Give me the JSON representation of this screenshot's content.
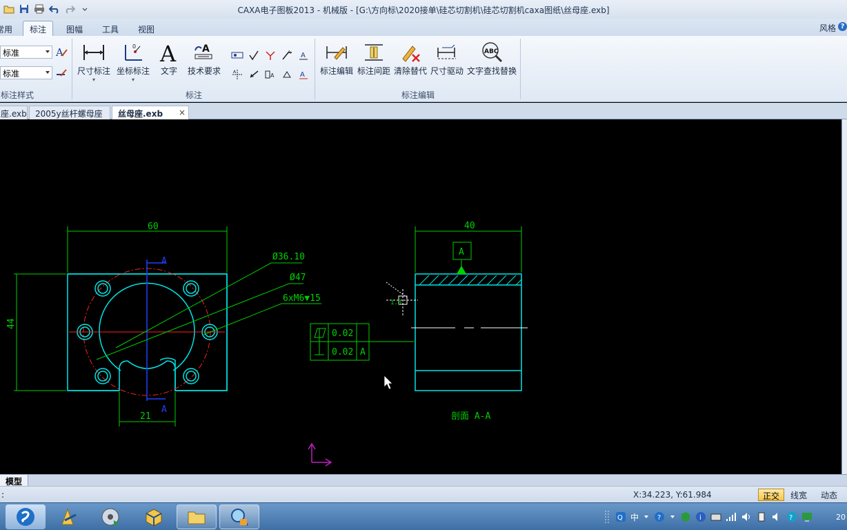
{
  "window": {
    "title": "CAXA电子图板2013 - 机械版 - [G:\\方向标\\2020接单\\硅芯切割机\\硅芯切割机caxa图纸\\丝母座.exb]"
  },
  "ribbon_tabs": [
    {
      "label": "常用",
      "active": false
    },
    {
      "label": "标注",
      "active": true
    },
    {
      "label": "图幅",
      "active": false
    },
    {
      "label": "工具",
      "active": false
    },
    {
      "label": "视图",
      "active": false
    }
  ],
  "ribbon_right": {
    "style_label": "风格",
    "help": "?"
  },
  "style_group": {
    "combo1": "标准",
    "combo2": "标准",
    "label": "标注样式"
  },
  "annotate_group": {
    "buttons": [
      "尺寸标注",
      "坐标标注",
      "文字",
      "技术要求"
    ],
    "label": "标注"
  },
  "edit_group": {
    "buttons": [
      "标注编辑",
      "标注间距",
      "清除替代",
      "尺寸驱动",
      "文字查找替换"
    ],
    "label": "标注编辑"
  },
  "doc_tabs": [
    {
      "label": "座.exb",
      "active": false
    },
    {
      "label": "2005y丝杆螺母座",
      "active": false
    },
    {
      "label": "丝母座.exb",
      "active": true
    }
  ],
  "drawing": {
    "dim_width": "60",
    "dim_height": "44",
    "dim_bottom": "21",
    "dim_d1": "Ø36.10",
    "dim_d2": "Ø47",
    "dim_holes": "6xM6▼15",
    "section_mark_a_top": "A",
    "section_mark_a_bottom": "A",
    "dim_side_width": "40",
    "datum_letter": "A",
    "tol_flat_value": "0.02",
    "tol_perp_value": "0.02",
    "tol_perp_datum": "A",
    "section_label": "剖面 A-A",
    "small_dim": "1.5"
  },
  "model_tab": "模型",
  "status": {
    "prompt": ":",
    "coordinates": "X:34.223, Y:61.984",
    "ortho": "正交",
    "linewidth": "线宽",
    "dynamic_input": "动态输入"
  },
  "tray": {
    "ime": "中",
    "clock": "20"
  },
  "colors": {
    "outline": "#00e5e5",
    "dimension": "#00d000",
    "centerline": "#ff2020",
    "axis": "#2040ff",
    "ucs": "#c020c0",
    "canvas": "#000000"
  }
}
